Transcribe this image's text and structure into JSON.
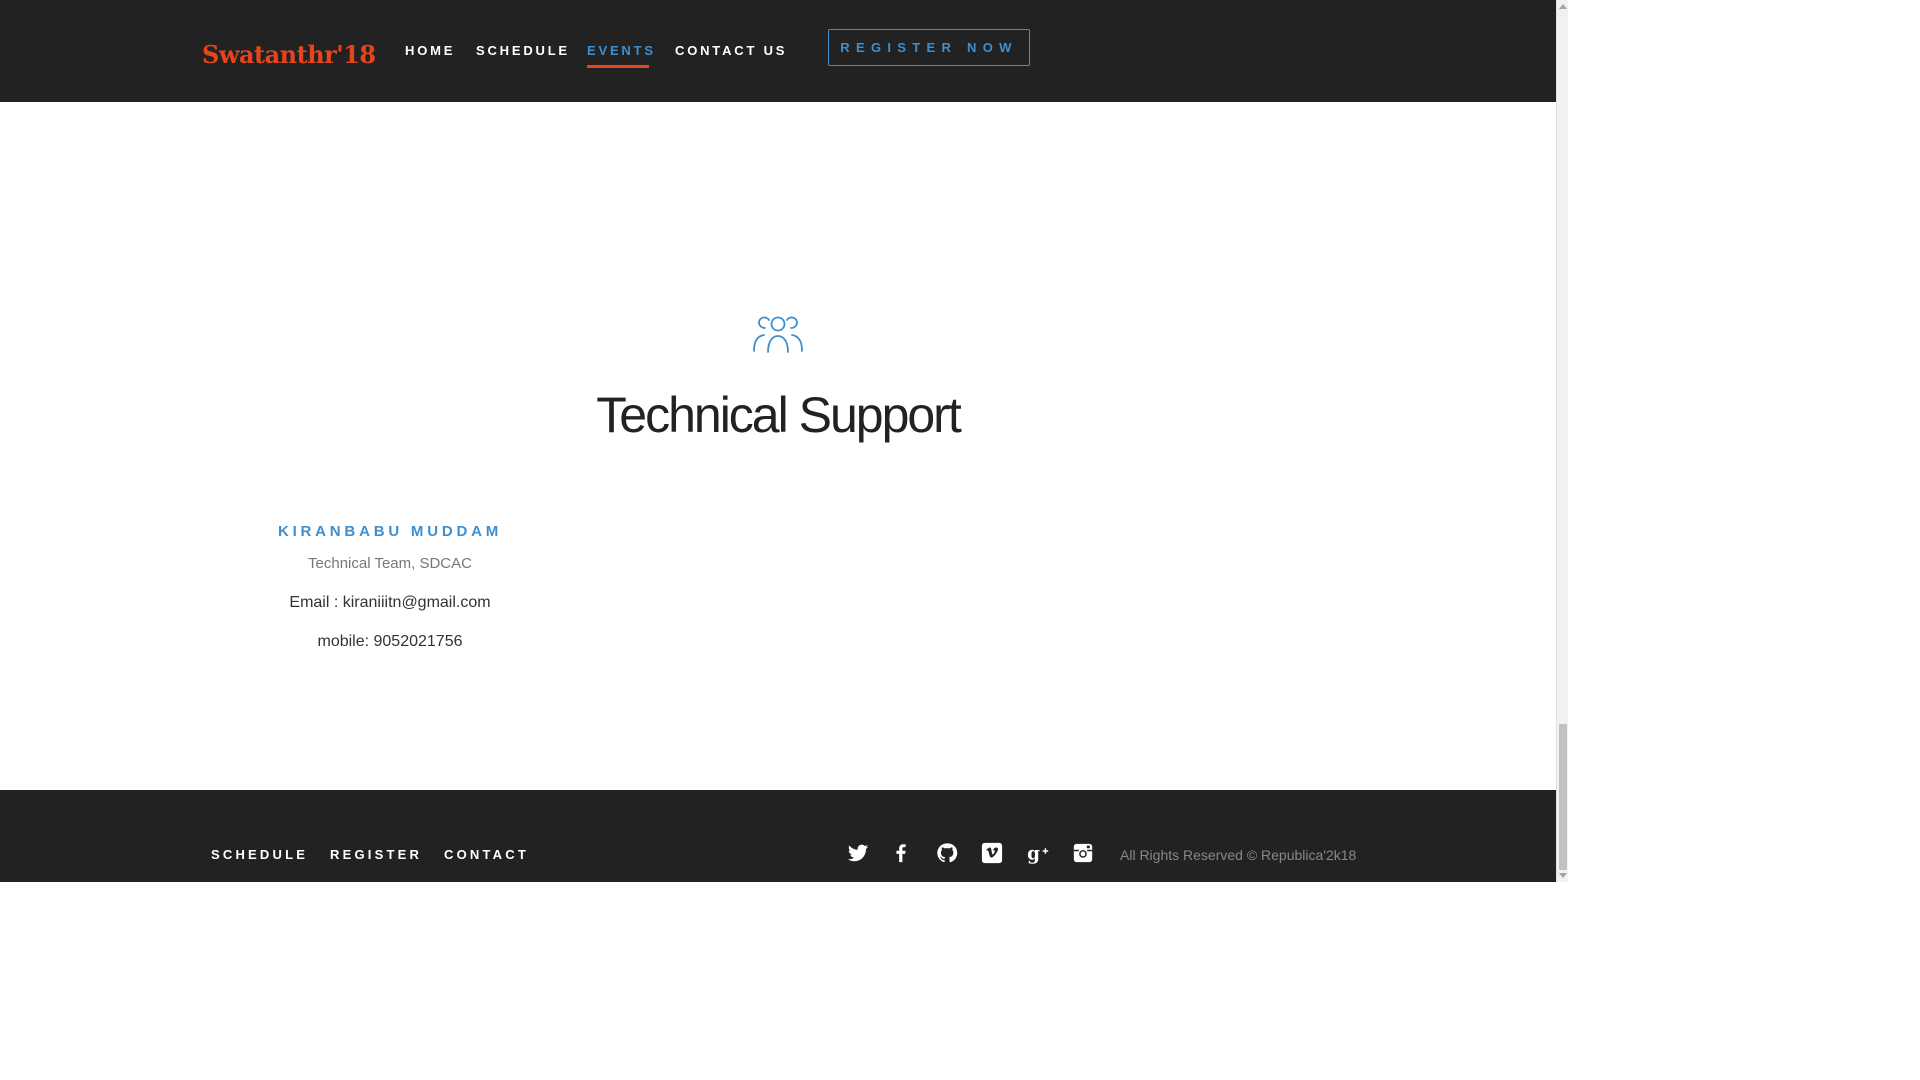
{
  "header": {
    "logo": "Swatanthr'18",
    "nav": [
      "HOME",
      "SCHEDULE",
      "EVENTS",
      "CONTACT US"
    ],
    "active_nav": "EVENTS",
    "register_button": "REGISTER NOW"
  },
  "section": {
    "icon": "team-icon",
    "title": "Technical Support",
    "member": {
      "name": "KIRANBABU MUDDAM",
      "role": "Technical Team, SDCAC",
      "email": "Email : kiraniiitn@gmail.com",
      "mobile": "mobile: 9052021756"
    }
  },
  "footer": {
    "links": [
      "SCHEDULE",
      "REGISTER",
      "CONTACT"
    ],
    "social_icons": [
      "twitter-icon",
      "facebook-icon",
      "github-icon",
      "vimeo-icon",
      "google-plus-icon",
      "instagram-icon"
    ],
    "copyright": "All Rights Reserved © Republica'2k18"
  },
  "colors": {
    "header_bg": "#222222",
    "accent_blue": "#3f8fcf",
    "accent_orange": "#e8441b"
  }
}
